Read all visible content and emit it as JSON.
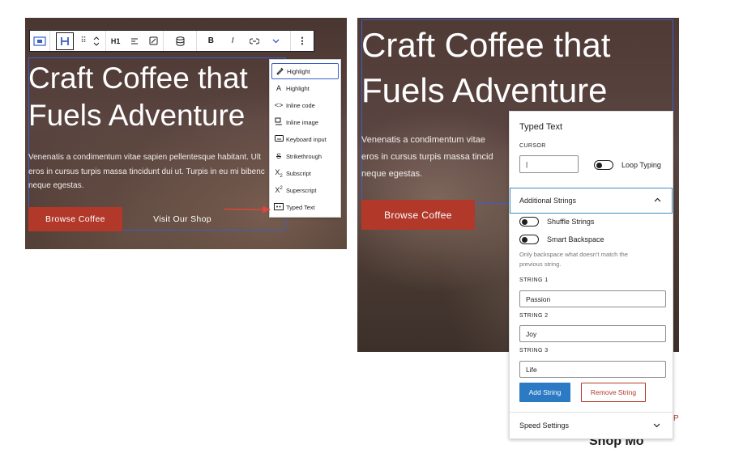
{
  "left": {
    "hero": {
      "title_line1": "Craft Coffee that",
      "title_line2": "Fuels Adventure",
      "body_line1": "Venenatis a condimentum vitae sapien pellentesque habitant. Ult",
      "body_line2": "eros in cursus turpis massa tincidunt dui ut. Turpis in eu mi bibenc",
      "body_line3": "neque egestas.",
      "browse_button": "Browse Coffee",
      "visit_button": "Visit Our Shop"
    },
    "toolbar": {
      "heading_level": "H1",
      "bold": "B",
      "italic": "I"
    },
    "format_menu": {
      "items": [
        {
          "label": "Highlight",
          "icon": "highlighter-icon",
          "active": true
        },
        {
          "label": "Highlight",
          "icon": "text-color-icon",
          "active": false
        },
        {
          "label": "Inline code",
          "icon": "code-icon",
          "active": false
        },
        {
          "label": "Inline image",
          "icon": "inline-image-icon",
          "active": false
        },
        {
          "label": "Keyboard input",
          "icon": "keyboard-icon",
          "active": false
        },
        {
          "label": "Strikethrough",
          "icon": "strikethrough-icon",
          "active": false
        },
        {
          "label": "Subscript",
          "icon": "subscript-icon",
          "active": false
        },
        {
          "label": "Superscript",
          "icon": "superscript-icon",
          "active": false
        },
        {
          "label": "Typed Text",
          "icon": "typed-text-icon",
          "active": false
        }
      ]
    }
  },
  "right": {
    "hero": {
      "title_line1": "Craft Coffee that",
      "title_line2": "Fuels Adventure",
      "body_line1": "Venenatis a condimentum vitae",
      "body_line2": "eros in cursus turpis massa tincid",
      "body_line3": "neque egestas.",
      "browse_button": "Browse Coffee",
      "bottom_fragment": "Shop Mo",
      "side_fragment": "P"
    },
    "settings": {
      "title": "Typed Text",
      "cursor_label": "CURSOR",
      "cursor_value": "|",
      "loop_label": "Loop Typing",
      "loop_enabled": false,
      "additional_heading": "Additional Strings",
      "shuffle_label": "Shuffle Strings",
      "shuffle_enabled": false,
      "smart_backspace_label": "Smart Backspace",
      "smart_backspace_enabled": false,
      "help_line1": "Only backspace what doesn't match the",
      "help_line2": "previous string.",
      "strings": [
        {
          "label": "STRING 1",
          "value": "Passion"
        },
        {
          "label": "STRING 2",
          "value": "Joy"
        },
        {
          "label": "STRING 3",
          "value": "Life"
        }
      ],
      "add_string": "Add String",
      "remove_string": "Remove String",
      "speed_heading": "Speed Settings"
    }
  },
  "colors": {
    "accent_blue": "#3a5fc8",
    "button_red": "#b2382a",
    "primary_button": "#2c7ac4",
    "panel_focus": "#3f8fbf"
  }
}
